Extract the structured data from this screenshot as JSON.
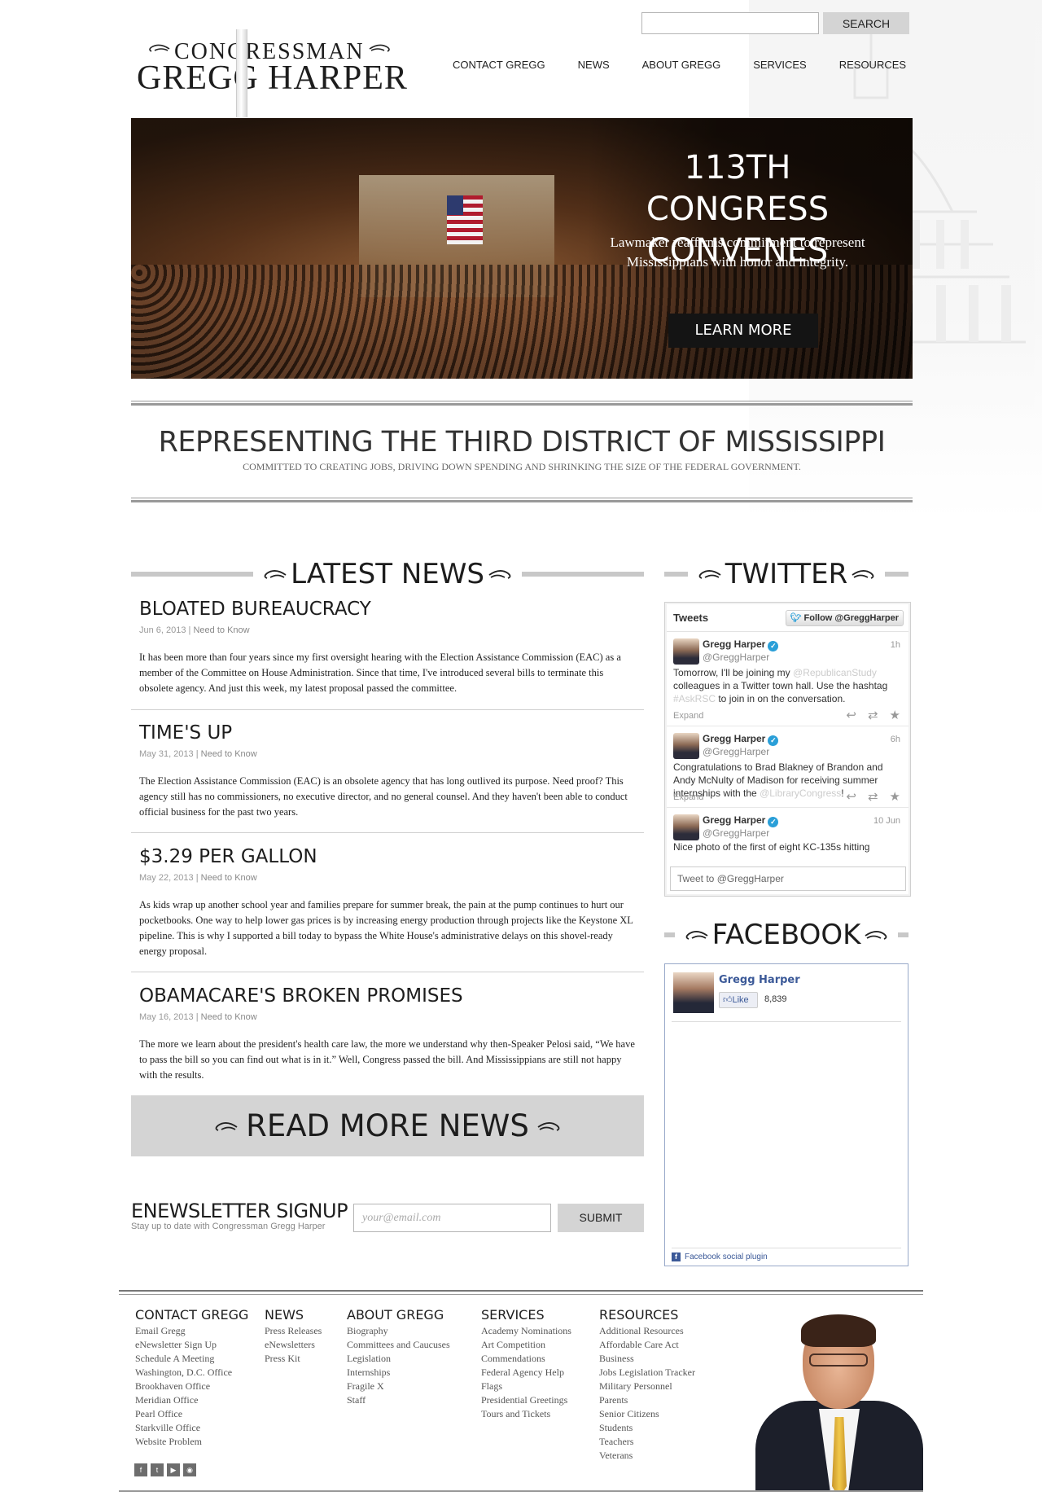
{
  "header": {
    "logo_line1": "CONGRESSMAN",
    "logo_line2": "GREGG HARPER",
    "search_placeholder": "",
    "search_button": "SEARCH",
    "nav": [
      "CONTACT GREGG",
      "NEWS",
      "ABOUT GREGG",
      "SERVICES",
      "RESOURCES"
    ]
  },
  "hero": {
    "title": "113TH CONGRESS CONVENES",
    "text": "Lawmaker reaffirms commitment to represent Mississippians with honor and integrity.",
    "button": "LEARN MORE"
  },
  "tagline": {
    "title": "REPRESENTING THE THIRD DISTRICT OF MISSISSIPPI",
    "subtitle": "COMMITTED TO CREATING JOBS, DRIVING DOWN SPENDING AND SHRINKING THE SIZE OF THE FEDERAL GOVERNMENT."
  },
  "news": {
    "heading": "LATEST NEWS",
    "items": [
      {
        "title": "BLOATED BUREAUCRACY",
        "date": "Jun 6, 2013",
        "category": "Need to Know",
        "body": "It has been more than four years since my first oversight hearing with the Election Assistance Commission (EAC) as a member of the Committee on House Administration. Since that time, I've introduced several bills to terminate this obsolete agency. And just this week, my latest proposal passed the committee."
      },
      {
        "title": "TIME'S UP",
        "date": "May 31, 2013",
        "category": "Need to Know",
        "body": "The Election Assistance Commission (EAC) is an obsolete agency that has long outlived its purpose. Need proof? This agency still has no commissioners, no executive director, and no general counsel. And they haven't been able to conduct official business for the past two years."
      },
      {
        "title": "$3.29 PER GALLON",
        "date": "May 22, 2013",
        "category": "Need to Know",
        "body": "As kids wrap up another school year and families prepare for summer break, the pain at the pump continues to hurt our pocketbooks. One way to help lower gas prices is by increasing energy production through projects like the Keystone XL pipeline. This is why I supported a bill today to bypass the White House's administrative delays on this shovel-ready energy proposal."
      },
      {
        "title": "OBAMACARE'S BROKEN PROMISES",
        "date": "May 16, 2013",
        "category": "Need to Know",
        "body": "The more we learn about the president's health care law, the more we understand why then-Speaker Pelosi said, “We have to pass the bill so you can find out what is in it.” Well, Congress passed the bill. And Mississippians are still not happy with the results."
      }
    ],
    "read_more": "READ MORE NEWS"
  },
  "newsletter": {
    "title": "ENEWSLETTER SIGNUP",
    "subtitle": "Stay up to date with Congressman Gregg Harper",
    "placeholder": "your@email.com",
    "button": "SUBMIT"
  },
  "twitter": {
    "heading": "TWITTER",
    "widget_title": "Tweets",
    "follow": "Follow @GreggHarper",
    "tweets": [
      {
        "name": "Gregg Harper",
        "handle": "@GreggHarper",
        "time": "1h",
        "text_a": "Tomorrow, I'll be joining my ",
        "link_a": "@RepublicanStudy",
        "text_b": " colleagues in a Twitter town hall. Use the hashtag ",
        "link_b": "#AskRSC",
        "text_c": " to join in on the conversation.",
        "expand": "Expand"
      },
      {
        "name": "Gregg Harper",
        "handle": "@GreggHarper",
        "time": "6h",
        "text_a": "Congratulations to Brad Blakney of Brandon and Andy McNulty of Madison for receiving summer internships with the ",
        "link_a": "@LibraryCongress",
        "text_b": "!",
        "expand": "Expand"
      },
      {
        "name": "Gregg Harper",
        "handle": "@GreggHarper",
        "time": "10 Jun",
        "text_a": "Nice photo of the first of eight KC-135s hitting"
      }
    ],
    "compose": "Tweet to @GreggHarper"
  },
  "facebook": {
    "heading": "FACEBOOK",
    "page_name": "Gregg Harper",
    "like": "Like",
    "count": "8,839",
    "footer": "Facebook social plugin"
  },
  "footer": {
    "columns": [
      {
        "title": "CONTACT GREGG",
        "links": [
          "Email Gregg",
          "eNewsletter Sign Up",
          "Schedule A Meeting",
          "Washington, D.C. Office",
          "Brookhaven Office",
          "Meridian Office",
          "Pearl Office",
          "Starkville Office",
          "Website Problem"
        ]
      },
      {
        "title": "NEWS",
        "links": [
          "Press Releases",
          "eNewsletters",
          "Press Kit"
        ]
      },
      {
        "title": "ABOUT GREGG",
        "links": [
          "Biography",
          "Committees and Caucuses",
          "Legislation",
          "Internships",
          "Fragile X",
          "Staff"
        ]
      },
      {
        "title": "SERVICES",
        "links": [
          "Academy Nominations",
          "Art Competition",
          "Commendations",
          "Federal Agency Help",
          "Flags",
          "Presidential Greetings",
          "Tours and Tickets"
        ]
      },
      {
        "title": "RESOURCES",
        "links": [
          "Additional Resources",
          "Affordable Care Act",
          "Business",
          "Jobs Legislation Tracker",
          "Military Personnel",
          "Parents",
          "Senior Citizens",
          "Students",
          "Teachers",
          "Veterans"
        ]
      }
    ],
    "social": [
      "facebook-icon",
      "twitter-icon",
      "youtube-icon",
      "rss-icon"
    ]
  }
}
